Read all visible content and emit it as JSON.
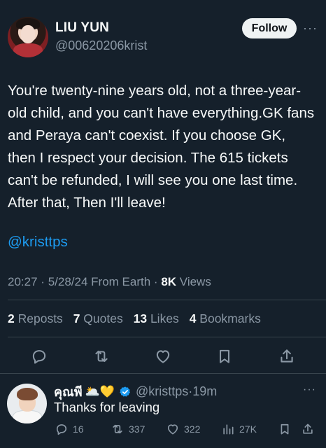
{
  "author": {
    "display_name": "LIU YUN",
    "handle": "@00620206krist",
    "follow_label": "Follow",
    "more_label": "···"
  },
  "tweet": {
    "text": "You're twenty-nine years old, not a three-year-old child, and you can't have everything.GK fans and Peraya can't coexist. If you choose GK, then I respect your decision. The 615 tickets can't be refunded, I will see you one last time. After that,  Then I'll leave!",
    "mention": "@kristtps",
    "time": "20:27",
    "date": "5/28/24",
    "source": "From Earth",
    "views_count": "8K",
    "views_label": "Views",
    "separator": "·"
  },
  "stats": {
    "reposts_count": "2",
    "reposts_label": "Reposts",
    "quotes_count": "7",
    "quotes_label": "Quotes",
    "likes_count": "13",
    "likes_label": "Likes",
    "bookmarks_count": "4",
    "bookmarks_label": "Bookmarks"
  },
  "actions": [
    "reply-icon",
    "repost-icon",
    "like-icon",
    "bookmark-icon",
    "share-icon"
  ],
  "reply": {
    "name": "คุณพี",
    "emoji": "🌥️💛",
    "handle": "@kristtps",
    "separator": "·",
    "time": "19m",
    "more_label": "···",
    "text": "Thanks for leaving",
    "reply_count": "16",
    "repost_count": "337",
    "like_count": "322",
    "views_count": "27K"
  },
  "colors": {
    "background": "#15202b",
    "text": "#f7f9f9",
    "muted": "#8b98a5",
    "link": "#1d9bf0",
    "divider": "#38444d",
    "verified": "#1d9bf0"
  }
}
